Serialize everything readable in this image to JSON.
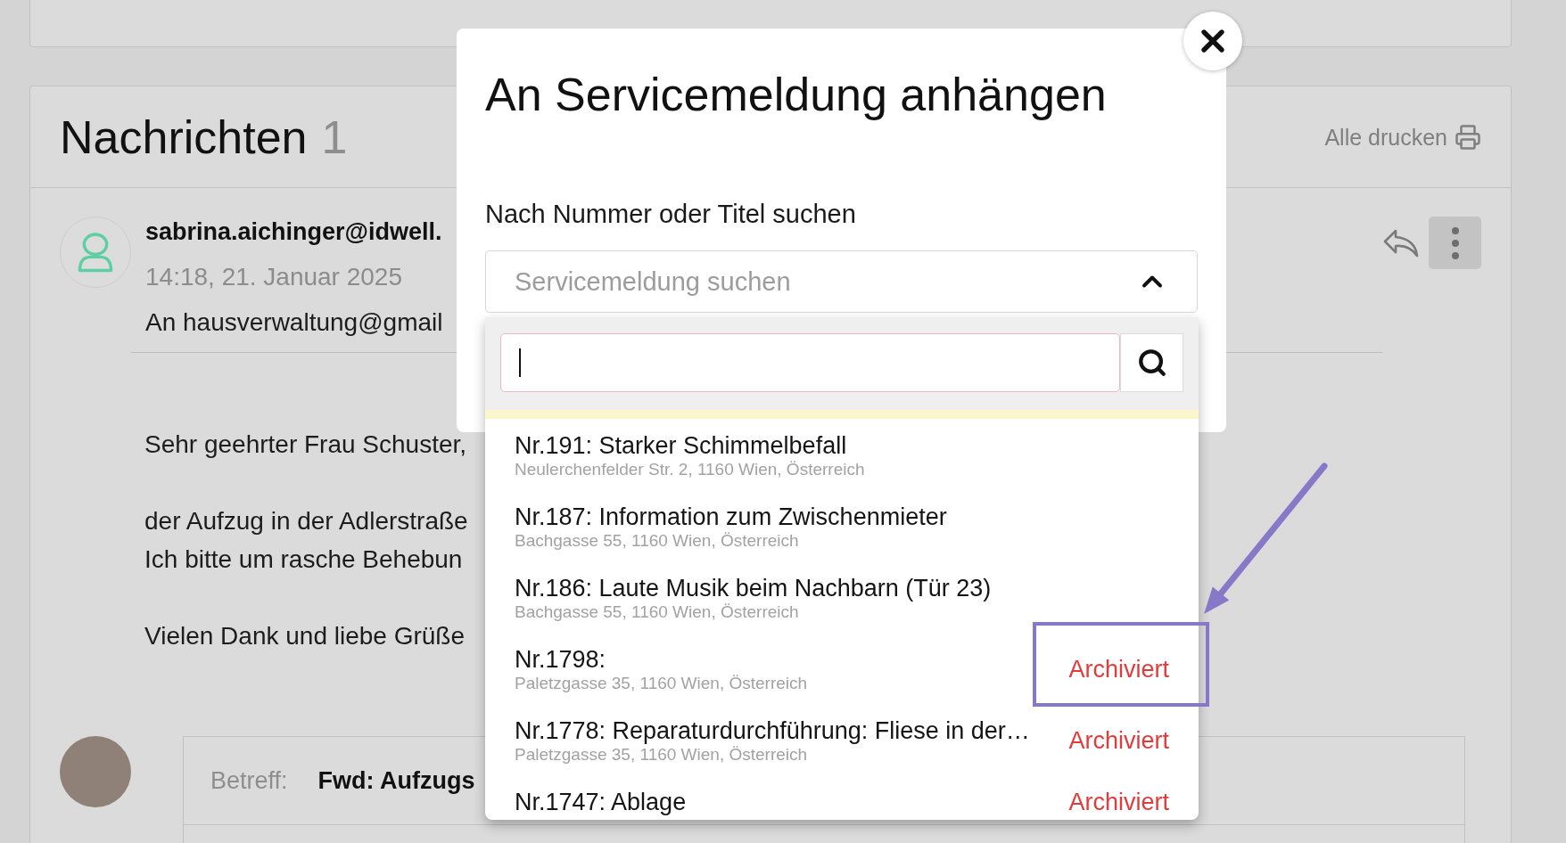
{
  "messages": {
    "title": "Nachrichten",
    "count": "1",
    "print_all": "Alle drucken"
  },
  "message": {
    "sender": "sabrina.aichinger@idwell.",
    "time": "14:18, 21. Januar 2025",
    "recipient": "An hausverwaltung@gmail",
    "body": [
      [
        "Sehr geehrter Frau Schuster,"
      ],
      [
        "der Aufzug in der Adlerstraße",
        "Ich bitte um rasche Behebun"
      ],
      [
        "Vielen Dank und liebe Grüße"
      ]
    ]
  },
  "forwarded": {
    "subject_label": "Betreff:",
    "subject": "Fwd: Aufzugs"
  },
  "dialog": {
    "title": "An Servicemeldung anhängen",
    "field_label": "Nach Nummer oder Titel suchen",
    "select": {
      "placeholder": "Servicemeldung suchen",
      "expanded": true
    },
    "search_field": {
      "focused": true
    },
    "results": [
      {
        "title": "Nr.191: Starker Schimmelbefall",
        "address": "Neulerchenfelder Str. 2, 1160 Wien, Österreich",
        "highlighted": false
      },
      {
        "title": "Nr.187: Information zum Zwischenmieter",
        "address": "Bachgasse 55, 1160 Wien, Österreich",
        "highlighted": false
      },
      {
        "title": "Nr.186: Laute Musik beim Nachbarn (Tür 23)",
        "address": "Bachgasse 55, 1160 Wien, Österreich",
        "highlighted": false
      },
      {
        "title": "Nr.1798:",
        "address": "Paletzgasse 35, 1160 Wien, Österreich",
        "status": "Archiviert",
        "highlighted": true
      },
      {
        "title": "Nr.1778: Reparaturdurchführung: Fliese in der…",
        "address": "Paletzgasse 35, 1160 Wien, Österreich",
        "status": "Archiviert",
        "highlighted": false
      },
      {
        "title": "Nr.1747: Ablage",
        "status": "Archiviert",
        "highlighted": false
      }
    ]
  }
}
